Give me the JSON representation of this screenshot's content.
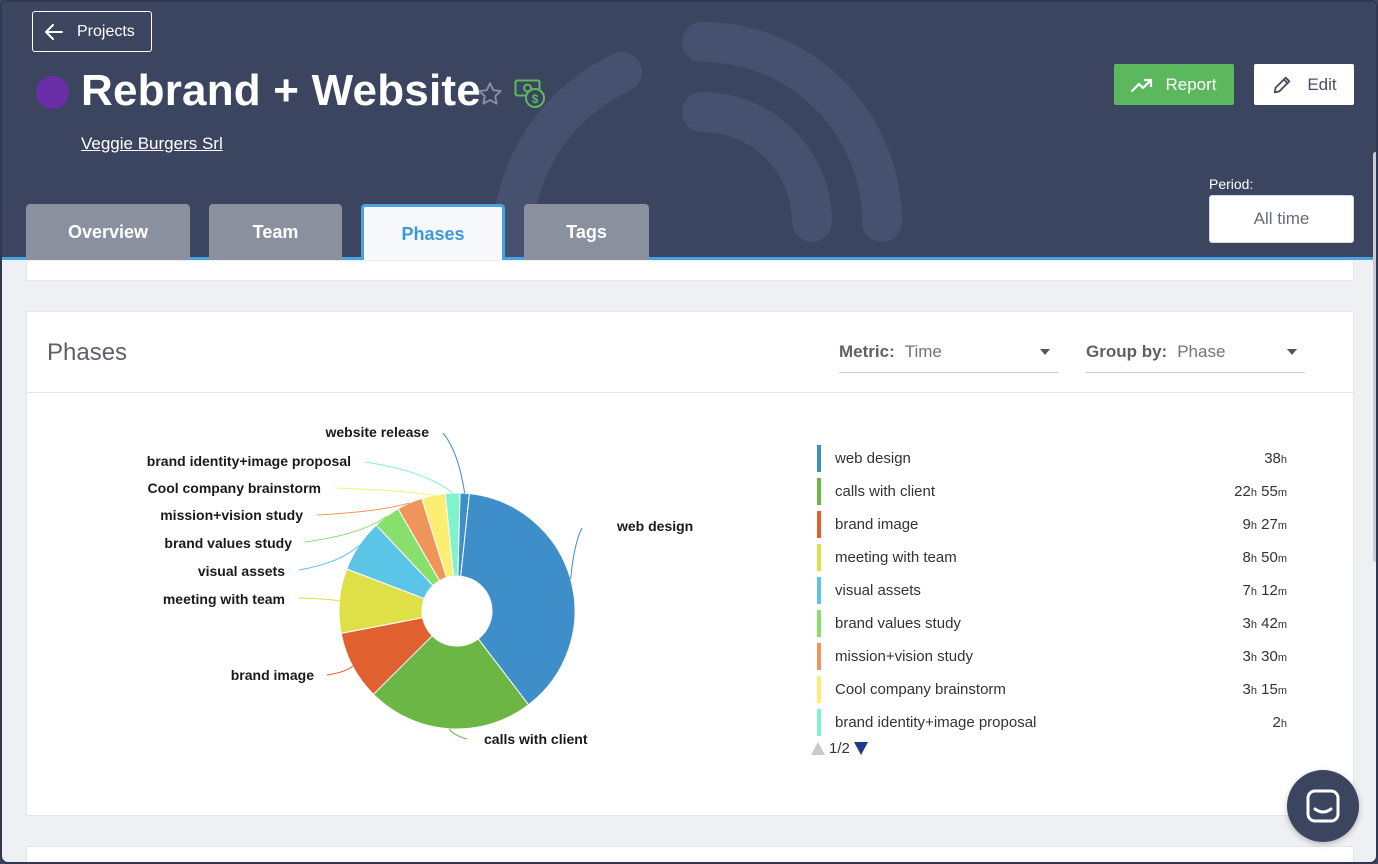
{
  "header": {
    "back_label": "Projects",
    "project_title": "Rebrand + Website",
    "project_color": "#6a2ea8",
    "client_name": "Veggie Burgers Srl",
    "report_label": "Report",
    "edit_label": "Edit",
    "period_label": "Period:",
    "period_value": "All time"
  },
  "tabs": [
    {
      "label": "Overview"
    },
    {
      "label": "Team"
    },
    {
      "label": "Phases",
      "active": true
    },
    {
      "label": "Tags"
    }
  ],
  "panel": {
    "title": "Phases",
    "metric_label": "Metric:",
    "metric_value": "Time",
    "groupby_label": "Group by:",
    "groupby_value": "Phase"
  },
  "chart_data": {
    "type": "pie",
    "donut": true,
    "categories": [
      "web design",
      "calls with client",
      "brand image",
      "meeting with team",
      "visual assets",
      "brand values study",
      "mission+vision study",
      "Cool company brainstorm",
      "brand identity+image proposal",
      "website release"
    ],
    "values": [
      38,
      22.9167,
      9.45,
      8.8333,
      7.2,
      3.7,
      3.5,
      3.25,
      2,
      1.25
    ],
    "colors": [
      "#3d8ec9",
      "#6cb645",
      "#e06030",
      "#dfe048",
      "#5bc5e8",
      "#88df6b",
      "#f0955a",
      "#fbee70",
      "#80f2cc",
      "#3d8ec9"
    ],
    "legend_placement": "right"
  },
  "legend": {
    "page": "1/2",
    "items": [
      {
        "name": "web design",
        "num1": "38",
        "unit1": "h",
        "num2": "",
        "unit2": "",
        "color": "#3d8ec9"
      },
      {
        "name": "calls with client",
        "num1": "22",
        "unit1": "h",
        "num2": "55",
        "unit2": "m",
        "color": "#6cb645"
      },
      {
        "name": "brand image",
        "num1": "9",
        "unit1": "h",
        "num2": "27",
        "unit2": "m",
        "color": "#e06030"
      },
      {
        "name": "meeting with team",
        "num1": "8",
        "unit1": "h",
        "num2": "50",
        "unit2": "m",
        "color": "#dfe048"
      },
      {
        "name": "visual assets",
        "num1": "7",
        "unit1": "h",
        "num2": "12",
        "unit2": "m",
        "color": "#5bc5e8"
      },
      {
        "name": "brand values study",
        "num1": "3",
        "unit1": "h",
        "num2": "42",
        "unit2": "m",
        "color": "#88df6b"
      },
      {
        "name": "mission+vision study",
        "num1": "3",
        "unit1": "h",
        "num2": "30",
        "unit2": "m",
        "color": "#f0955a"
      },
      {
        "name": "Cool company brainstorm",
        "num1": "3",
        "unit1": "h",
        "num2": "15",
        "unit2": "m",
        "color": "#fbee70"
      },
      {
        "name": "brand identity+image proposal",
        "num1": "2",
        "unit1": "h",
        "num2": "",
        "unit2": "",
        "color": "#80f2cc"
      }
    ]
  }
}
